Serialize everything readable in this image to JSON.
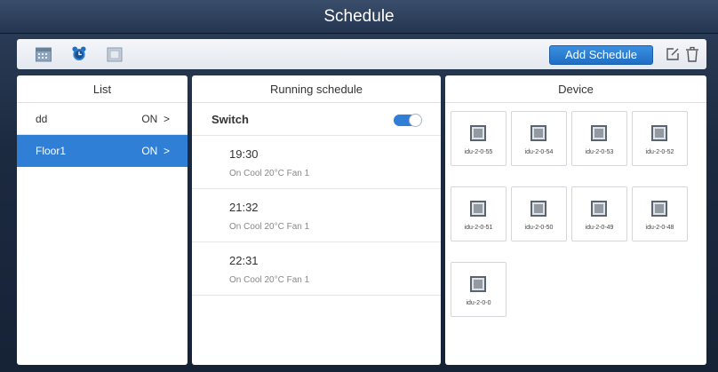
{
  "app": {
    "title": "Schedule"
  },
  "toolbar": {
    "add_label": "Add Schedule",
    "icons": [
      "calendar-icon",
      "alarm-clock-icon",
      "square-icon",
      "edit-icon",
      "trash-icon"
    ]
  },
  "list": {
    "header": "List",
    "items": [
      {
        "name": "dd",
        "status": "ON  >"
      },
      {
        "name": "Floor1",
        "status": "ON  >"
      }
    ]
  },
  "running": {
    "header": "Running schedule",
    "switch_label": "Switch",
    "switch_on": true,
    "items": [
      {
        "time": "19:30",
        "desc": "On Cool 20°C Fan 1"
      },
      {
        "time": "21:32",
        "desc": "On Cool 20°C Fan 1"
      },
      {
        "time": "22:31",
        "desc": "On Cool 20°C Fan 1"
      }
    ]
  },
  "device": {
    "header": "Device",
    "items": [
      {
        "name": "idu-2-0-55"
      },
      {
        "name": "idu-2-0-54"
      },
      {
        "name": "idu-2-0-53"
      },
      {
        "name": "idu-2-0-52"
      },
      {
        "name": "idu-2-0-51"
      },
      {
        "name": "idu-2-0-50"
      },
      {
        "name": "idu-2-0-49"
      },
      {
        "name": "idu-2-0-48"
      },
      {
        "name": "idu-2-0-0"
      }
    ]
  },
  "colors": {
    "accent": "#2f7fd6",
    "title_bar": "#2d3f5a"
  }
}
